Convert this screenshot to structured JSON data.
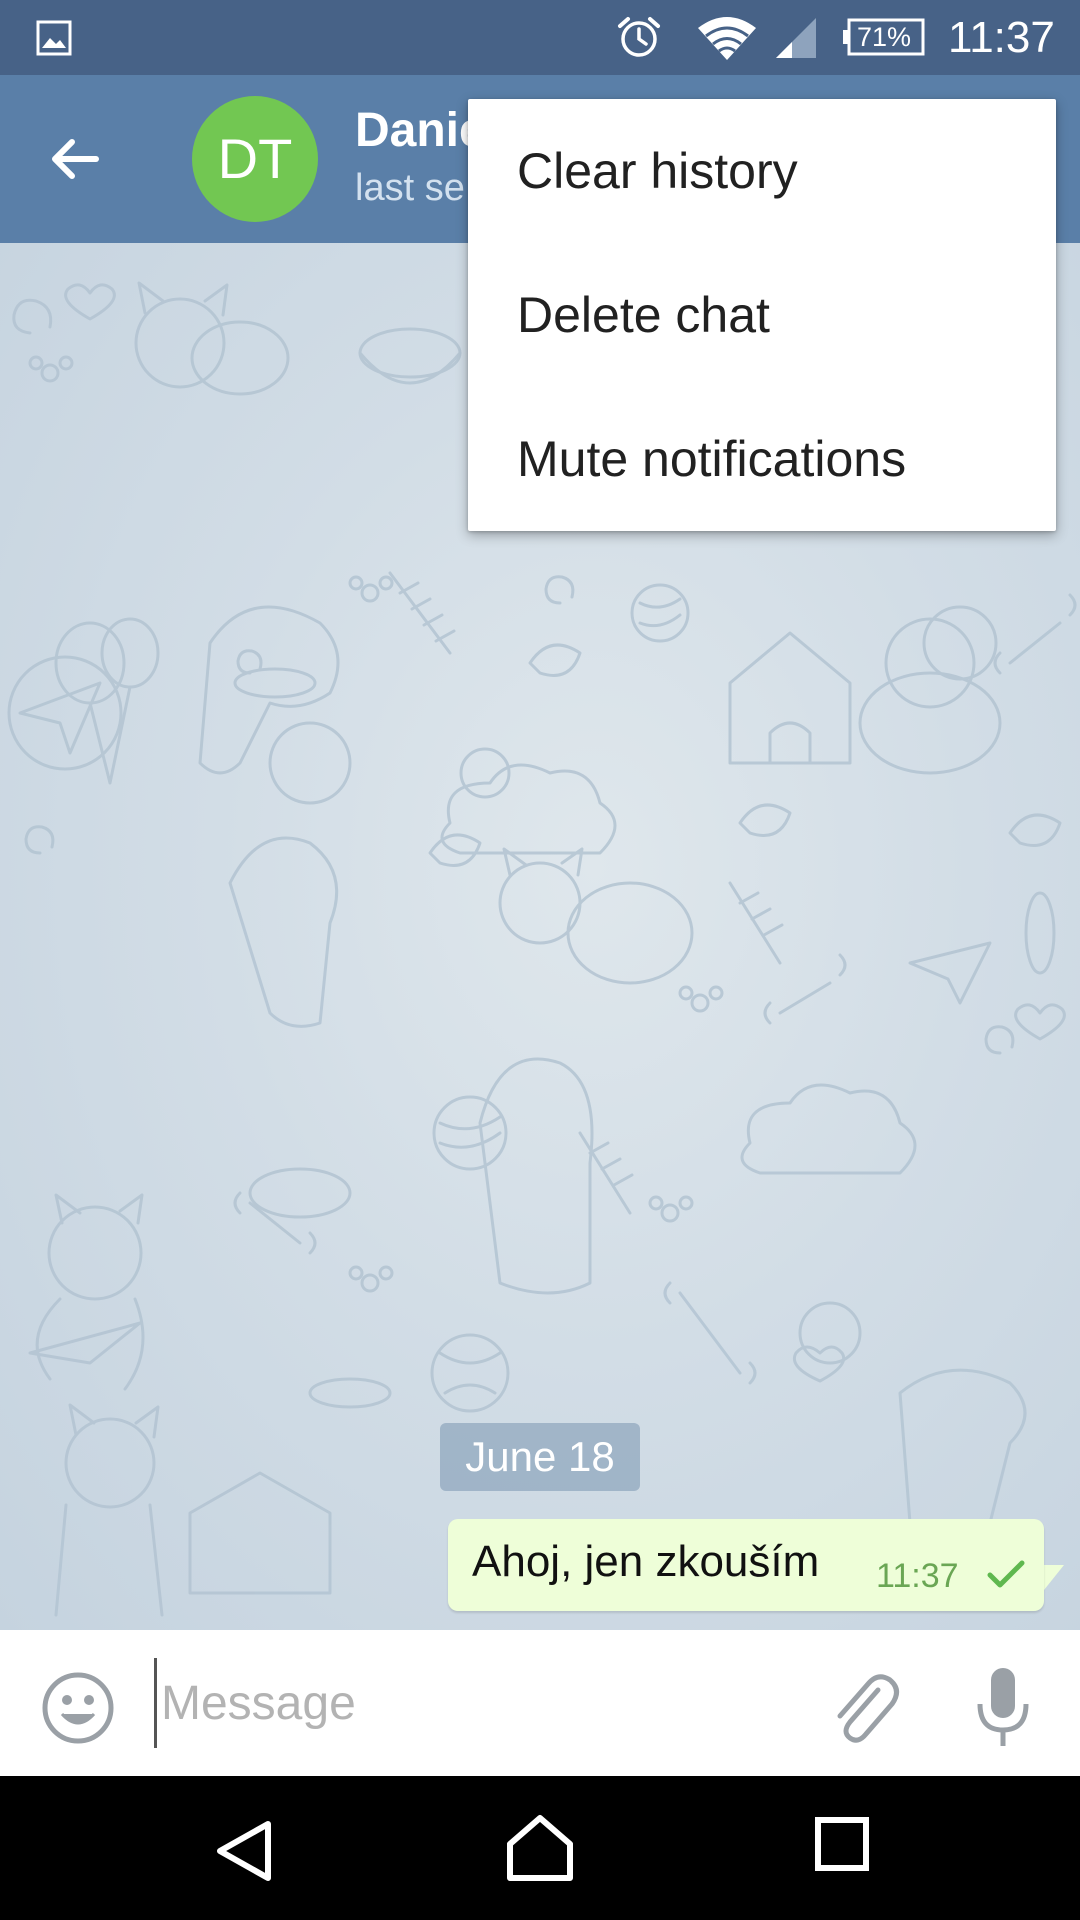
{
  "status_bar": {
    "battery_percent": "71%",
    "time": "11:37",
    "icons": [
      "gallery-icon",
      "alarm-icon",
      "wifi-icon",
      "signal-icon",
      "battery-icon"
    ]
  },
  "header": {
    "avatar_initials": "DT",
    "avatar_color": "#72c752",
    "title": "Danie",
    "subtitle": "last se",
    "bar_color": "#5a7fa8"
  },
  "menu": {
    "items": [
      {
        "label": "Clear history"
      },
      {
        "label": "Delete chat"
      },
      {
        "label": "Mute notifications"
      }
    ]
  },
  "chat": {
    "date_label": "June 18",
    "messages": [
      {
        "text": "Ahoj, jen zkouším",
        "time": "11:37",
        "status": "sent",
        "outgoing": true
      }
    ]
  },
  "input": {
    "placeholder": "Message",
    "value": ""
  },
  "nav": {
    "icons": [
      "back-triangle-icon",
      "home-icon",
      "recents-icon"
    ]
  }
}
